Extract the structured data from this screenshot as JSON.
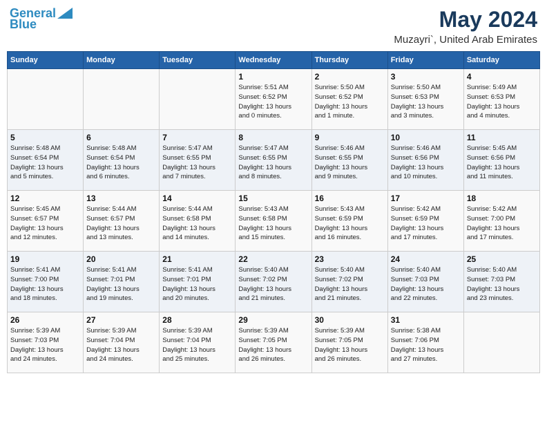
{
  "header": {
    "logo_line1": "General",
    "logo_line2": "Blue",
    "main_title": "May 2024",
    "subtitle": "Muzayri`, United Arab Emirates"
  },
  "days_of_week": [
    "Sunday",
    "Monday",
    "Tuesday",
    "Wednesday",
    "Thursday",
    "Friday",
    "Saturday"
  ],
  "weeks": [
    [
      {
        "day": "",
        "info": ""
      },
      {
        "day": "",
        "info": ""
      },
      {
        "day": "",
        "info": ""
      },
      {
        "day": "1",
        "info": "Sunrise: 5:51 AM\nSunset: 6:52 PM\nDaylight: 13 hours\nand 0 minutes."
      },
      {
        "day": "2",
        "info": "Sunrise: 5:50 AM\nSunset: 6:52 PM\nDaylight: 13 hours\nand 1 minute."
      },
      {
        "day": "3",
        "info": "Sunrise: 5:50 AM\nSunset: 6:53 PM\nDaylight: 13 hours\nand 3 minutes."
      },
      {
        "day": "4",
        "info": "Sunrise: 5:49 AM\nSunset: 6:53 PM\nDaylight: 13 hours\nand 4 minutes."
      }
    ],
    [
      {
        "day": "5",
        "info": "Sunrise: 5:48 AM\nSunset: 6:54 PM\nDaylight: 13 hours\nand 5 minutes."
      },
      {
        "day": "6",
        "info": "Sunrise: 5:48 AM\nSunset: 6:54 PM\nDaylight: 13 hours\nand 6 minutes."
      },
      {
        "day": "7",
        "info": "Sunrise: 5:47 AM\nSunset: 6:55 PM\nDaylight: 13 hours\nand 7 minutes."
      },
      {
        "day": "8",
        "info": "Sunrise: 5:47 AM\nSunset: 6:55 PM\nDaylight: 13 hours\nand 8 minutes."
      },
      {
        "day": "9",
        "info": "Sunrise: 5:46 AM\nSunset: 6:55 PM\nDaylight: 13 hours\nand 9 minutes."
      },
      {
        "day": "10",
        "info": "Sunrise: 5:46 AM\nSunset: 6:56 PM\nDaylight: 13 hours\nand 10 minutes."
      },
      {
        "day": "11",
        "info": "Sunrise: 5:45 AM\nSunset: 6:56 PM\nDaylight: 13 hours\nand 11 minutes."
      }
    ],
    [
      {
        "day": "12",
        "info": "Sunrise: 5:45 AM\nSunset: 6:57 PM\nDaylight: 13 hours\nand 12 minutes."
      },
      {
        "day": "13",
        "info": "Sunrise: 5:44 AM\nSunset: 6:57 PM\nDaylight: 13 hours\nand 13 minutes."
      },
      {
        "day": "14",
        "info": "Sunrise: 5:44 AM\nSunset: 6:58 PM\nDaylight: 13 hours\nand 14 minutes."
      },
      {
        "day": "15",
        "info": "Sunrise: 5:43 AM\nSunset: 6:58 PM\nDaylight: 13 hours\nand 15 minutes."
      },
      {
        "day": "16",
        "info": "Sunrise: 5:43 AM\nSunset: 6:59 PM\nDaylight: 13 hours\nand 16 minutes."
      },
      {
        "day": "17",
        "info": "Sunrise: 5:42 AM\nSunset: 6:59 PM\nDaylight: 13 hours\nand 17 minutes."
      },
      {
        "day": "18",
        "info": "Sunrise: 5:42 AM\nSunset: 7:00 PM\nDaylight: 13 hours\nand 17 minutes."
      }
    ],
    [
      {
        "day": "19",
        "info": "Sunrise: 5:41 AM\nSunset: 7:00 PM\nDaylight: 13 hours\nand 18 minutes."
      },
      {
        "day": "20",
        "info": "Sunrise: 5:41 AM\nSunset: 7:01 PM\nDaylight: 13 hours\nand 19 minutes."
      },
      {
        "day": "21",
        "info": "Sunrise: 5:41 AM\nSunset: 7:01 PM\nDaylight: 13 hours\nand 20 minutes."
      },
      {
        "day": "22",
        "info": "Sunrise: 5:40 AM\nSunset: 7:02 PM\nDaylight: 13 hours\nand 21 minutes."
      },
      {
        "day": "23",
        "info": "Sunrise: 5:40 AM\nSunset: 7:02 PM\nDaylight: 13 hours\nand 21 minutes."
      },
      {
        "day": "24",
        "info": "Sunrise: 5:40 AM\nSunset: 7:03 PM\nDaylight: 13 hours\nand 22 minutes."
      },
      {
        "day": "25",
        "info": "Sunrise: 5:40 AM\nSunset: 7:03 PM\nDaylight: 13 hours\nand 23 minutes."
      }
    ],
    [
      {
        "day": "26",
        "info": "Sunrise: 5:39 AM\nSunset: 7:03 PM\nDaylight: 13 hours\nand 24 minutes."
      },
      {
        "day": "27",
        "info": "Sunrise: 5:39 AM\nSunset: 7:04 PM\nDaylight: 13 hours\nand 24 minutes."
      },
      {
        "day": "28",
        "info": "Sunrise: 5:39 AM\nSunset: 7:04 PM\nDaylight: 13 hours\nand 25 minutes."
      },
      {
        "day": "29",
        "info": "Sunrise: 5:39 AM\nSunset: 7:05 PM\nDaylight: 13 hours\nand 26 minutes."
      },
      {
        "day": "30",
        "info": "Sunrise: 5:39 AM\nSunset: 7:05 PM\nDaylight: 13 hours\nand 26 minutes."
      },
      {
        "day": "31",
        "info": "Sunrise: 5:38 AM\nSunset: 7:06 PM\nDaylight: 13 hours\nand 27 minutes."
      },
      {
        "day": "",
        "info": ""
      }
    ]
  ]
}
